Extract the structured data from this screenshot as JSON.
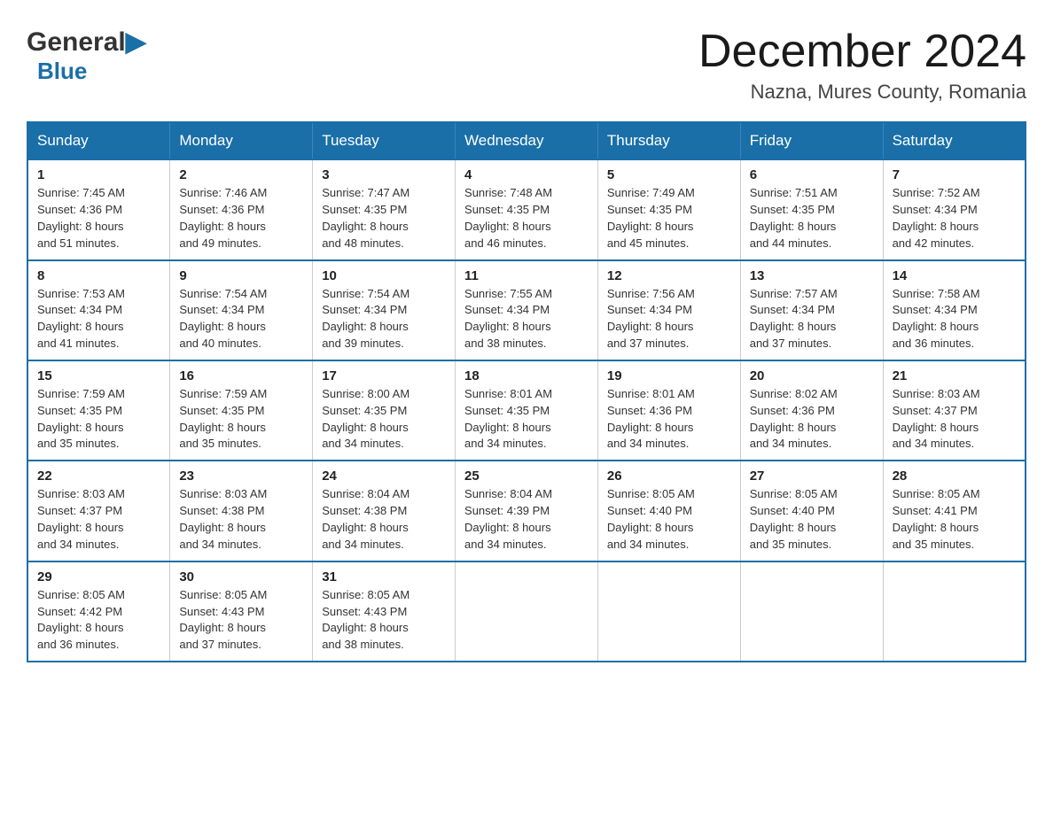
{
  "header": {
    "month_title": "December 2024",
    "location": "Nazna, Mures County, Romania",
    "logo_general": "General",
    "logo_blue": "Blue"
  },
  "columns": [
    "Sunday",
    "Monday",
    "Tuesday",
    "Wednesday",
    "Thursday",
    "Friday",
    "Saturday"
  ],
  "weeks": [
    [
      {
        "day": "1",
        "sunrise": "7:45 AM",
        "sunset": "4:36 PM",
        "daylight": "8 hours and 51 minutes."
      },
      {
        "day": "2",
        "sunrise": "7:46 AM",
        "sunset": "4:36 PM",
        "daylight": "8 hours and 49 minutes."
      },
      {
        "day": "3",
        "sunrise": "7:47 AM",
        "sunset": "4:35 PM",
        "daylight": "8 hours and 48 minutes."
      },
      {
        "day": "4",
        "sunrise": "7:48 AM",
        "sunset": "4:35 PM",
        "daylight": "8 hours and 46 minutes."
      },
      {
        "day": "5",
        "sunrise": "7:49 AM",
        "sunset": "4:35 PM",
        "daylight": "8 hours and 45 minutes."
      },
      {
        "day": "6",
        "sunrise": "7:51 AM",
        "sunset": "4:35 PM",
        "daylight": "8 hours and 44 minutes."
      },
      {
        "day": "7",
        "sunrise": "7:52 AM",
        "sunset": "4:34 PM",
        "daylight": "8 hours and 42 minutes."
      }
    ],
    [
      {
        "day": "8",
        "sunrise": "7:53 AM",
        "sunset": "4:34 PM",
        "daylight": "8 hours and 41 minutes."
      },
      {
        "day": "9",
        "sunrise": "7:54 AM",
        "sunset": "4:34 PM",
        "daylight": "8 hours and 40 minutes."
      },
      {
        "day": "10",
        "sunrise": "7:54 AM",
        "sunset": "4:34 PM",
        "daylight": "8 hours and 39 minutes."
      },
      {
        "day": "11",
        "sunrise": "7:55 AM",
        "sunset": "4:34 PM",
        "daylight": "8 hours and 38 minutes."
      },
      {
        "day": "12",
        "sunrise": "7:56 AM",
        "sunset": "4:34 PM",
        "daylight": "8 hours and 37 minutes."
      },
      {
        "day": "13",
        "sunrise": "7:57 AM",
        "sunset": "4:34 PM",
        "daylight": "8 hours and 37 minutes."
      },
      {
        "day": "14",
        "sunrise": "7:58 AM",
        "sunset": "4:34 PM",
        "daylight": "8 hours and 36 minutes."
      }
    ],
    [
      {
        "day": "15",
        "sunrise": "7:59 AM",
        "sunset": "4:35 PM",
        "daylight": "8 hours and 35 minutes."
      },
      {
        "day": "16",
        "sunrise": "7:59 AM",
        "sunset": "4:35 PM",
        "daylight": "8 hours and 35 minutes."
      },
      {
        "day": "17",
        "sunrise": "8:00 AM",
        "sunset": "4:35 PM",
        "daylight": "8 hours and 34 minutes."
      },
      {
        "day": "18",
        "sunrise": "8:01 AM",
        "sunset": "4:35 PM",
        "daylight": "8 hours and 34 minutes."
      },
      {
        "day": "19",
        "sunrise": "8:01 AM",
        "sunset": "4:36 PM",
        "daylight": "8 hours and 34 minutes."
      },
      {
        "day": "20",
        "sunrise": "8:02 AM",
        "sunset": "4:36 PM",
        "daylight": "8 hours and 34 minutes."
      },
      {
        "day": "21",
        "sunrise": "8:03 AM",
        "sunset": "4:37 PM",
        "daylight": "8 hours and 34 minutes."
      }
    ],
    [
      {
        "day": "22",
        "sunrise": "8:03 AM",
        "sunset": "4:37 PM",
        "daylight": "8 hours and 34 minutes."
      },
      {
        "day": "23",
        "sunrise": "8:03 AM",
        "sunset": "4:38 PM",
        "daylight": "8 hours and 34 minutes."
      },
      {
        "day": "24",
        "sunrise": "8:04 AM",
        "sunset": "4:38 PM",
        "daylight": "8 hours and 34 minutes."
      },
      {
        "day": "25",
        "sunrise": "8:04 AM",
        "sunset": "4:39 PM",
        "daylight": "8 hours and 34 minutes."
      },
      {
        "day": "26",
        "sunrise": "8:05 AM",
        "sunset": "4:40 PM",
        "daylight": "8 hours and 34 minutes."
      },
      {
        "day": "27",
        "sunrise": "8:05 AM",
        "sunset": "4:40 PM",
        "daylight": "8 hours and 35 minutes."
      },
      {
        "day": "28",
        "sunrise": "8:05 AM",
        "sunset": "4:41 PM",
        "daylight": "8 hours and 35 minutes."
      }
    ],
    [
      {
        "day": "29",
        "sunrise": "8:05 AM",
        "sunset": "4:42 PM",
        "daylight": "8 hours and 36 minutes."
      },
      {
        "day": "30",
        "sunrise": "8:05 AM",
        "sunset": "4:43 PM",
        "daylight": "8 hours and 37 minutes."
      },
      {
        "day": "31",
        "sunrise": "8:05 AM",
        "sunset": "4:43 PM",
        "daylight": "8 hours and 38 minutes."
      },
      null,
      null,
      null,
      null
    ]
  ]
}
